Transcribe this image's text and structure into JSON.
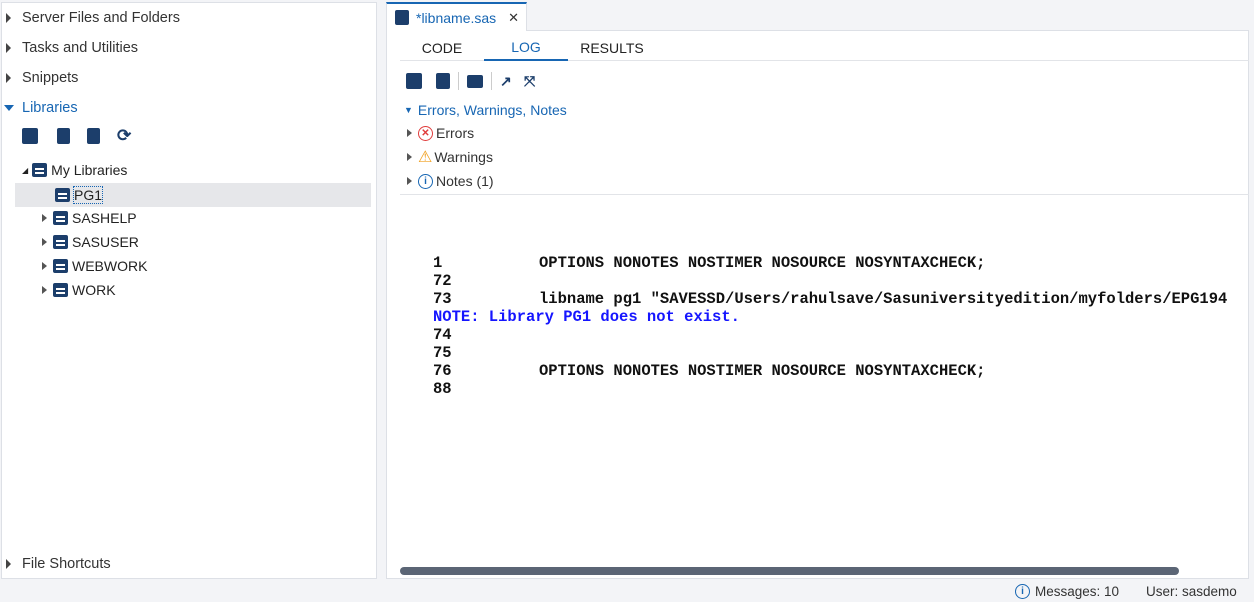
{
  "left": {
    "sections": [
      {
        "label": "Server Files and Folders"
      },
      {
        "label": "Tasks and Utilities"
      },
      {
        "label": "Snippets"
      },
      {
        "label": "Libraries"
      }
    ],
    "bottom_section": "File Shortcuts",
    "toolbar": [
      "new-library-icon",
      "delete-icon",
      "properties-icon",
      "refresh-icon"
    ],
    "tree": {
      "root": "My Libraries",
      "items": [
        "PG1",
        "SASHELP",
        "SASUSER",
        "WEBWORK",
        "WORK"
      ]
    }
  },
  "editor": {
    "tab_label": "*libname.sas",
    "subtabs": [
      "CODE",
      "LOG",
      "RESULTS"
    ],
    "active_subtab": "LOG",
    "summary": {
      "title": "Errors, Warnings, Notes",
      "errors": "Errors",
      "warnings": "Warnings",
      "notes": "Notes (1)"
    },
    "log": [
      {
        "n": "1",
        "text": "OPTIONS NONOTES NOSTIMER NOSOURCE NOSYNTAXCHECK;"
      },
      {
        "n": "72",
        "text": ""
      },
      {
        "n": "73",
        "text": "libname pg1 \"SAVESSD/Users/rahulsave/Sasuniversityedition/myfolders/EPG194"
      },
      {
        "note": "NOTE: Library PG1 does not exist."
      },
      {
        "n": "74",
        "text": ""
      },
      {
        "n": "75",
        "text": ""
      },
      {
        "n": "76",
        "text": "OPTIONS NONOTES NOSTIMER NOSOURCE NOSYNTAXCHECK;"
      },
      {
        "n": "88",
        "text": ""
      }
    ]
  },
  "status": {
    "messages": "Messages: 10",
    "user": "User: sasdemo"
  },
  "colors": {
    "accent": "#1766b3",
    "navy": "#1c3e6b",
    "note": "#1515ff",
    "error": "#e03c3c",
    "warning": "#f0a020"
  }
}
